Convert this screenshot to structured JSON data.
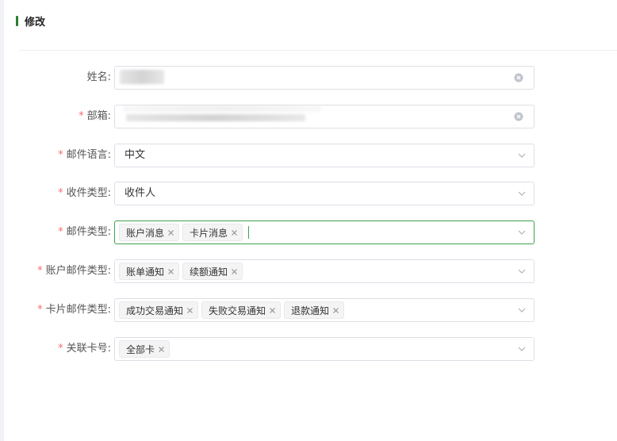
{
  "header": {
    "title": "修改"
  },
  "form": {
    "name": {
      "label": "姓名:",
      "required": false
    },
    "email": {
      "label": "部箱:",
      "required": true
    },
    "mail_language": {
      "label": "邮件语言:",
      "required": true,
      "value": "中文"
    },
    "recipient_type": {
      "label": "收件类型:",
      "required": true,
      "value": "收件人"
    },
    "mail_type": {
      "label": "邮件类型:",
      "required": true,
      "tags": [
        "账户消息",
        "卡片消息"
      ]
    },
    "account_mail_type": {
      "label": "账户邮件类型:",
      "required": true,
      "tags": [
        "账单通知",
        "续额通知"
      ]
    },
    "card_mail_type": {
      "label": "卡片邮件类型:",
      "required": true,
      "tags": [
        "成功交易通知",
        "失败交易通知",
        "退款通知"
      ]
    },
    "linked_card": {
      "label": "关联卡号:",
      "required": true,
      "tags": [
        "全部卡"
      ]
    }
  },
  "required_mark": "*",
  "colors": {
    "accent": "#3fa34d",
    "required": "#f56c6c",
    "border": "#dcdfe6"
  },
  "icons": {
    "select": "chevron-down-icon",
    "clear": "circle-clear-icon",
    "tag_remove": "close-icon"
  }
}
